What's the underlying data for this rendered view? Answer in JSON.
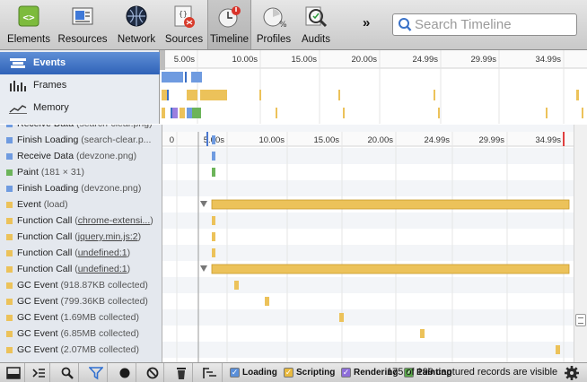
{
  "toolbar": {
    "items": [
      {
        "label": "Elements",
        "icon": "elements-icon"
      },
      {
        "label": "Resources",
        "icon": "resources-icon"
      },
      {
        "label": "Network",
        "icon": "network-icon"
      },
      {
        "label": "Sources",
        "icon": "sources-icon"
      },
      {
        "label": "Timeline",
        "icon": "timeline-icon",
        "selected": true
      },
      {
        "label": "Profiles",
        "icon": "profiles-icon"
      },
      {
        "label": "Audits",
        "icon": "audits-icon"
      }
    ],
    "overflow": "»",
    "search_placeholder": "Search Timeline"
  },
  "overview": {
    "items": [
      {
        "label": "Events",
        "icon": "events-icon",
        "selected": true
      },
      {
        "label": "Frames",
        "icon": "frames-icon"
      },
      {
        "label": "Memory",
        "icon": "memory-icon"
      }
    ],
    "ticks": [
      "5.00s",
      "10.00s",
      "15.00s",
      "20.00s",
      "24.99s",
      "29.99s",
      "34.99s"
    ]
  },
  "ruler": {
    "ticks": [
      "0",
      "5.00s",
      "10.00s",
      "15.00s",
      "20.00s",
      "24.99s",
      "29.99s",
      "34.99s"
    ]
  },
  "records": [
    {
      "category": "loading",
      "name": "Receive Data",
      "details": "(search-clear.png)",
      "link": false,
      "partial": true
    },
    {
      "category": "loading",
      "name": "Finish Loading",
      "details": "(search-clear.p...",
      "link": false
    },
    {
      "category": "loading",
      "name": "Receive Data",
      "details": "(devzone.png)",
      "link": false
    },
    {
      "category": "painting",
      "name": "Paint",
      "details": "(181 × 31)",
      "link": false
    },
    {
      "category": "loading",
      "name": "Finish Loading",
      "details": "(devzone.png)",
      "link": false
    },
    {
      "category": "scripting",
      "name": "Event",
      "details": "(load)",
      "link": false,
      "expandable": true
    },
    {
      "category": "scripting",
      "name": "Function Call",
      "details": "chrome-extensi...",
      "link": true
    },
    {
      "category": "scripting",
      "name": "Function Call",
      "details": "jquery.min.js:2",
      "link": true
    },
    {
      "category": "scripting",
      "name": "Function Call",
      "details": "undefined:1",
      "link": true
    },
    {
      "category": "scripting",
      "name": "Function Call",
      "details": "undefined:1",
      "link": true,
      "expandable": true
    },
    {
      "category": "scripting",
      "name": "GC Event",
      "details": "(918.87KB collected)",
      "link": false
    },
    {
      "category": "scripting",
      "name": "GC Event",
      "details": "(799.36KB collected)",
      "link": false
    },
    {
      "category": "scripting",
      "name": "GC Event",
      "details": "(1.69MB collected)",
      "link": false
    },
    {
      "category": "scripting",
      "name": "GC Event",
      "details": "(6.85MB collected)",
      "link": false
    },
    {
      "category": "scripting",
      "name": "GC Event",
      "details": "(2.07MB collected)",
      "link": false
    }
  ],
  "filters": [
    {
      "label": "Loading",
      "color": "#5a8fd9",
      "checked": true
    },
    {
      "label": "Scripting",
      "color": "#e8b93e",
      "checked": true
    },
    {
      "label": "Rendering",
      "color": "#8d6ed8",
      "checked": true
    },
    {
      "label": "Painting",
      "color": "#5aa64a",
      "checked": true
    }
  ],
  "status": "175 of 199 captured records are visible",
  "colors": {
    "loading": "#6f9be0",
    "scripting": "#ecc25a",
    "rendering": "#9b7fe0",
    "painting": "#6cb45a",
    "selected": "#3b6fc4"
  }
}
